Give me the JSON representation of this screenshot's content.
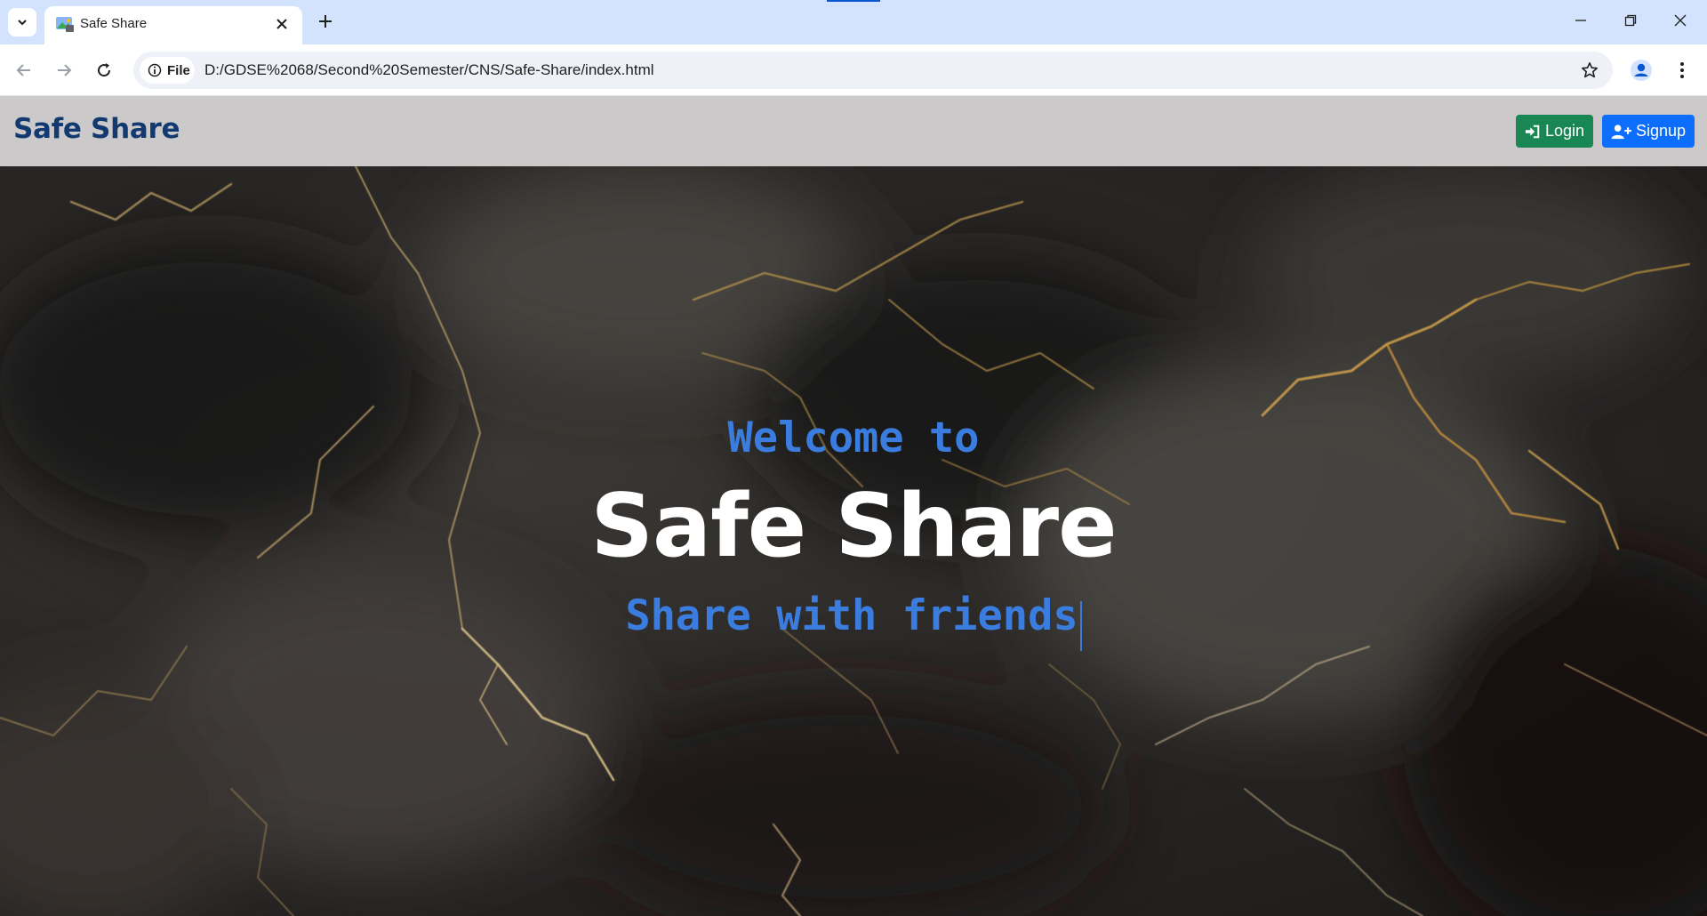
{
  "browser": {
    "tab": {
      "title": "Safe Share",
      "close_icon": "close-icon",
      "favicon": "landscape-favicon-icon"
    },
    "new_tab_icon": "plus-icon",
    "address": {
      "chip_label": "File",
      "url": "D:/GDSE%2068/Second%20Semester/CNS/Safe-Share/index.html"
    },
    "accent": "#0b57d0",
    "tabstrip_color": "#d3e3fd"
  },
  "site": {
    "brand": "Safe Share",
    "brand_color": "#123a70",
    "nav_bg": "#cbc9c9",
    "login": {
      "label": "Login",
      "icon": "sign-in-icon",
      "color": "#198754"
    },
    "signup": {
      "label": "Signup",
      "icon": "user-plus-icon",
      "color": "#0d6efd"
    }
  },
  "hero": {
    "welcome": "Welcome to",
    "title": "Safe Share",
    "tagline": "Share with friends",
    "text_accent": "#3b7dde",
    "background": "dark-gold-veined-marble"
  }
}
